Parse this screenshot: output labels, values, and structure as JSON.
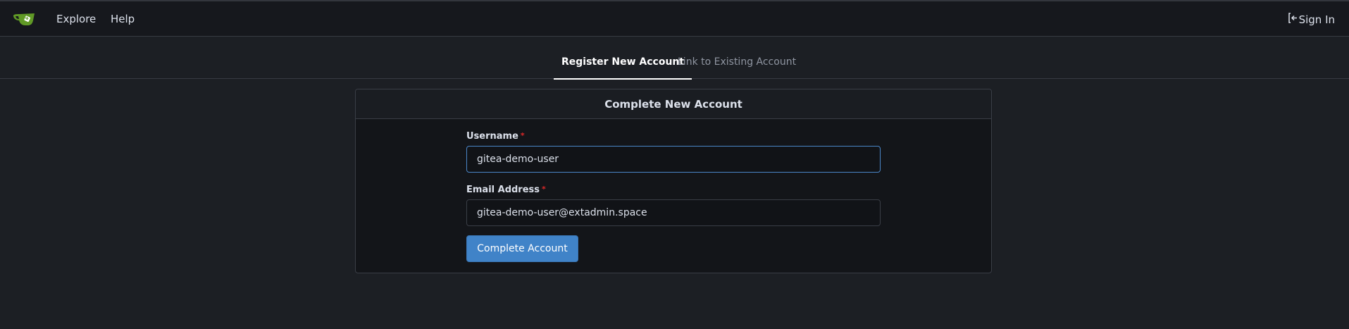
{
  "navbar": {
    "logo_name": "gitea-logo-icon",
    "links": [
      {
        "label": "Explore"
      },
      {
        "label": "Help"
      }
    ],
    "signin_label": "Sign In",
    "signin_icon": "sign-in-icon"
  },
  "tabs": [
    {
      "label": "Register New Account",
      "active": true
    },
    {
      "label": "Link to Existing Account",
      "active": false
    }
  ],
  "form": {
    "title": "Complete New Account",
    "username": {
      "label": "Username",
      "required_marker": "*",
      "value": "gitea-demo-user"
    },
    "email": {
      "label": "Email Address",
      "required_marker": "*",
      "value": "gitea-demo-user@extadmin.space"
    },
    "submit_label": "Complete Account"
  },
  "colors": {
    "background": "#1c1f24",
    "navbar": "#16181d",
    "accent": "#4083c8",
    "logo_green": "#609926",
    "required": "#db2828"
  }
}
